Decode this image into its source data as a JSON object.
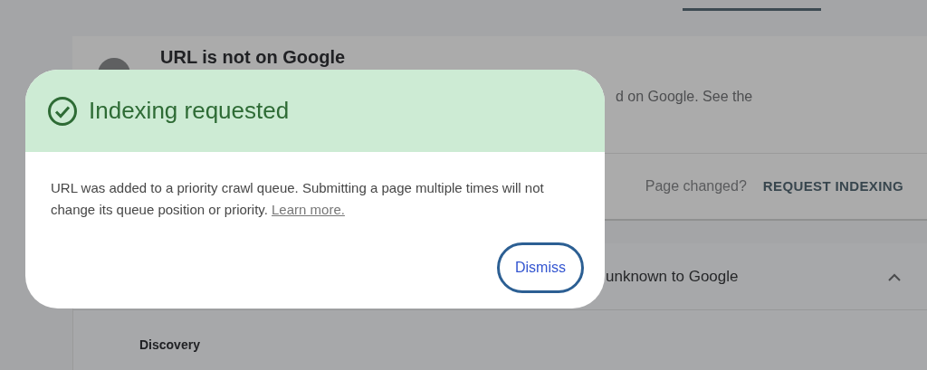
{
  "background": {
    "status_card": {
      "title": "URL is not on Google",
      "description": "d on Google. See the",
      "prompt": "Page changed?",
      "action": "REQUEST INDEXING"
    },
    "details_card": {
      "heading": "unknown to Google",
      "expanded": true,
      "section": "Discovery"
    }
  },
  "dialog": {
    "title": "Indexing requested",
    "message": "URL was added to a priority crawl queue. Submitting a page multiple times will not change its queue position or priority.",
    "link": "Learn more.",
    "buttons": [
      "Dismiss"
    ]
  }
}
